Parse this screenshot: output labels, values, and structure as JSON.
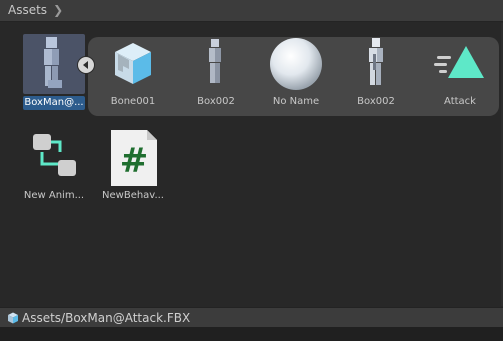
{
  "header": {
    "breadcrumb": "Assets"
  },
  "items": [
    {
      "label": "BoxMan@...",
      "icon": "model-prefab-icon",
      "selected": true
    },
    {
      "label": "Bone001",
      "icon": "prefab-box-icon"
    },
    {
      "label": "Box002",
      "icon": "mesh-figure-icon"
    },
    {
      "label": "No Name",
      "icon": "material-sphere-icon"
    },
    {
      "label": "Box002",
      "icon": "avatar-figure-icon"
    },
    {
      "label": "Attack",
      "icon": "animation-clip-icon"
    },
    {
      "label": "New Anim...",
      "icon": "animator-controller-icon"
    },
    {
      "label": "NewBehav...",
      "icon": "csharp-script-icon"
    }
  ],
  "footer": {
    "path": "Assets/BoxMan@Attack.FBX"
  },
  "colors": {
    "accent": "#2d5c8d",
    "teal": "#5ee8c8",
    "script_green": "#1f6e2f"
  }
}
